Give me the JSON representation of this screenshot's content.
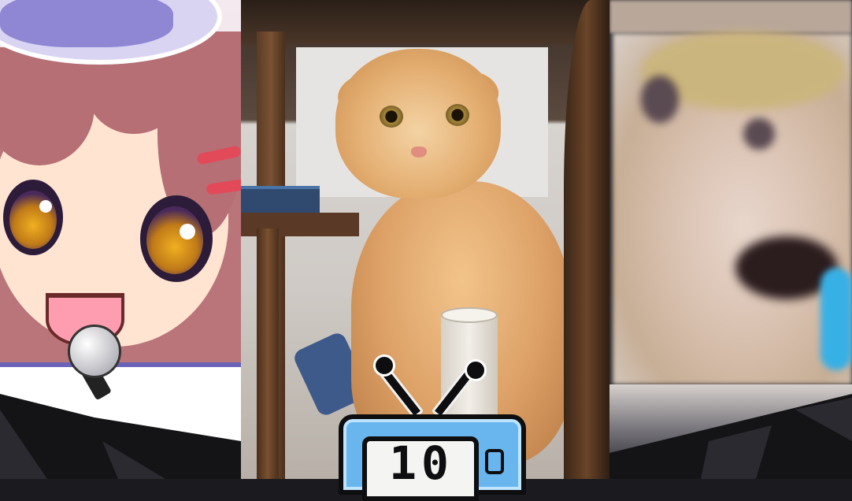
{
  "panels": {
    "left": {
      "subject": "anime-singer-with-microphone"
    },
    "center": {
      "subject": "orange-cat-sitting"
    },
    "right": {
      "subject": "blurred-screaming-cat"
    }
  },
  "mascot": {
    "counter_text": "10",
    "colors": {
      "body": "#69b6ee",
      "outline": "#0e0e10",
      "screen": "#f4f4f2"
    }
  },
  "colors": {
    "background": "#1b1b1f",
    "hair": "#b9757a",
    "cat_fur": "#dca066",
    "accent_blue": "#37b0e6"
  }
}
